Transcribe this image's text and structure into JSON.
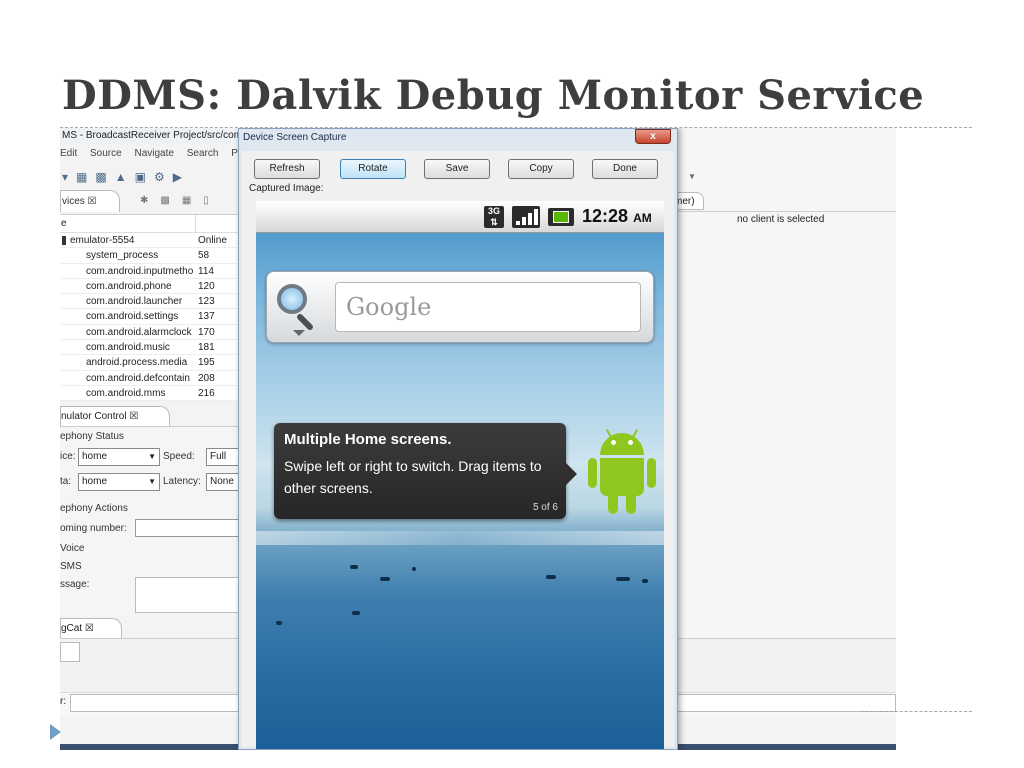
{
  "slide": {
    "title": "DDMS: Dalvik Debug Monitor Service"
  },
  "eclipse": {
    "window_title": "MS - BroadcastReceiver Project/src/com",
    "menu": [
      "Edit",
      "Source",
      "Navigate",
      "Search",
      "Pr"
    ],
    "devices_tab": "vices ☒",
    "devices_table": {
      "header": "e",
      "rows": [
        {
          "name": "emulator-5554",
          "value": "Online",
          "root": true
        },
        {
          "name": "system_process",
          "value": "58"
        },
        {
          "name": "com.android.inputmetho",
          "value": "114"
        },
        {
          "name": "com.android.phone",
          "value": "120"
        },
        {
          "name": "com.android.launcher",
          "value": "123"
        },
        {
          "name": "com.android.settings",
          "value": "137"
        },
        {
          "name": "com.android.alarmclock",
          "value": "170"
        },
        {
          "name": "com.android.music",
          "value": "181"
        },
        {
          "name": "android.process.media",
          "value": "195"
        },
        {
          "name": "com.android.defcontain",
          "value": "208"
        },
        {
          "name": "com.android.mms",
          "value": "216"
        }
      ]
    },
    "emulator_control": {
      "tab": "nulator Control ☒",
      "telephony_status": "ephony Status",
      "voice_label": "ice:",
      "voice_value": "home",
      "speed_label": "Speed:",
      "speed_value": "Full",
      "data_label": "ta:",
      "data_value": "home",
      "latency_label": "Latency:",
      "latency_value": "None",
      "telephony_actions": "ephony Actions",
      "incoming_label": "oming number:",
      "voice_radio": "Voice",
      "sms_radio": "SMS",
      "message_label": "ssage:"
    },
    "logcat_tab": "gCat ☒",
    "filter_label": "r:",
    "right_tab_fragment": "mer)",
    "no_client": "no client is selected"
  },
  "dialog": {
    "title": "Device Screen Capture",
    "close_label": "x",
    "buttons": {
      "refresh": "Refresh",
      "rotate": "Rotate",
      "save": "Save",
      "copy": "Copy",
      "done": "Done"
    },
    "captured_label": "Captured Image:"
  },
  "phone": {
    "network": "3G",
    "time": "12:28",
    "ampm": "AM",
    "search_placeholder": "Google",
    "tooltip": {
      "title": "Multiple Home screens.",
      "text": "Swipe left or right to switch. Drag items to other screens.",
      "page": "5 of 6"
    }
  },
  "colors": {
    "title_text": "#3e3e3e",
    "bullet": "#6f9fc8",
    "android_green": "#8fc71f",
    "battery_green": "#58b700"
  }
}
